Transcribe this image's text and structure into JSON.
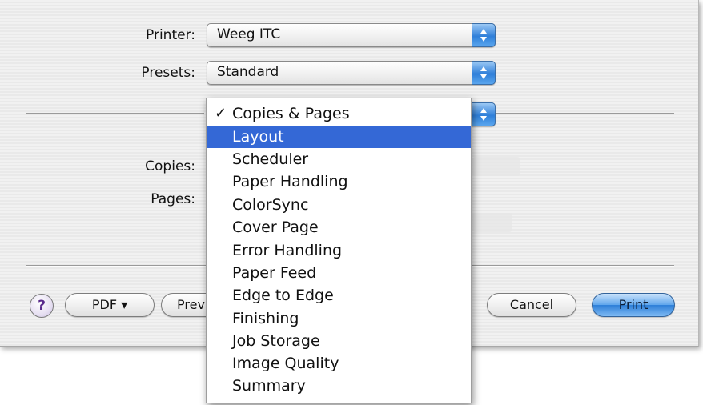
{
  "dialog": {
    "printer_label": "Printer:",
    "printer_value": "Weeg ITC",
    "presets_label": "Presets:",
    "presets_value": "Standard",
    "copies_label": "Copies:",
    "pages_label": "Pages:"
  },
  "buttons": {
    "help": "?",
    "pdf": "PDF ▾",
    "preview": "Prev",
    "cancel": "Cancel",
    "print": "Print"
  },
  "panel_menu": {
    "selected": "Copies & Pages",
    "highlighted": "Layout",
    "items": [
      {
        "label": "Copies & Pages",
        "checked": true
      },
      {
        "label": "Layout",
        "highlighted": true
      },
      {
        "label": "Scheduler"
      },
      {
        "label": "Paper Handling"
      },
      {
        "label": "ColorSync"
      },
      {
        "label": "Cover Page"
      },
      {
        "label": "Error Handling"
      },
      {
        "label": "Paper Feed"
      },
      {
        "label": "Edge to Edge"
      },
      {
        "label": "Finishing"
      },
      {
        "label": "Job Storage"
      },
      {
        "label": "Image Quality"
      },
      {
        "label": "Summary"
      }
    ]
  },
  "colors": {
    "menu_highlight": "#3468d6",
    "stepper_blue": "#2f7fd9",
    "print_button": "#2c7ed8"
  }
}
